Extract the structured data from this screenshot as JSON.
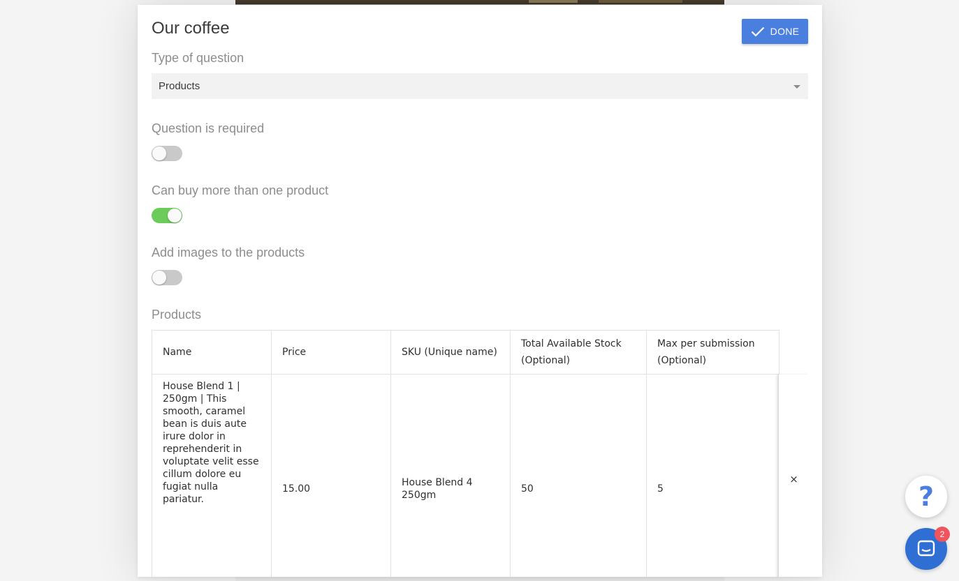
{
  "modal": {
    "title": "Our coffee",
    "done_label": "DONE",
    "type_label": "Type of question",
    "type_value": "Products",
    "required_label": "Question is required",
    "required_on": false,
    "multi_label": "Can buy more than one product",
    "multi_on": true,
    "images_label": "Add images to the products",
    "images_on": false,
    "products_label": "Products"
  },
  "table": {
    "headers": [
      "Name",
      "Price",
      "SKU (Unique name)",
      "Total Available Stock (Optional)",
      "Max per submission (Optional)"
    ],
    "rows": [
      {
        "name": "House Blend 1 | 250gm | This smooth, caramel bean is duis aute irure dolor in reprehenderit in voluptate velit esse cillum dolore eu fugiat nulla pariatur.",
        "price": "15.00",
        "sku": "House Blend 4 250gm",
        "stock": "50",
        "max": "5",
        "delete_label": "×"
      }
    ]
  },
  "widgets": {
    "help_label": "?",
    "chat_badge": "2"
  },
  "colors": {
    "accent": "#4a7fe0",
    "toggle_on": "#6ccb5a",
    "badge": "#f0545c"
  }
}
